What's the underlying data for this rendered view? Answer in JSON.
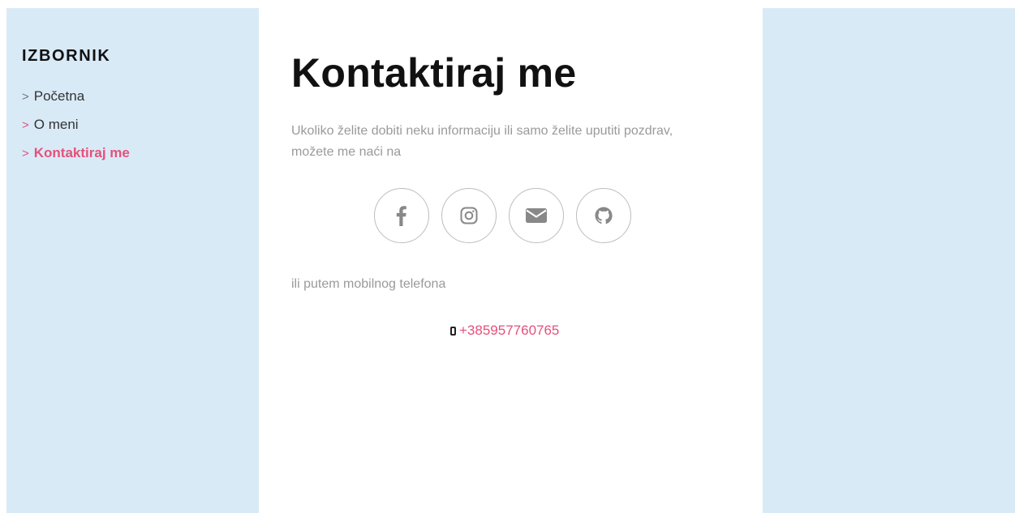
{
  "sidebar": {
    "title": "IZBORNIK",
    "items": [
      {
        "label": "Početna",
        "chevron": ">"
      },
      {
        "label": "O meni",
        "chevron": ">"
      },
      {
        "label": "Kontaktiraj me",
        "chevron": ">",
        "active": true
      }
    ]
  },
  "main": {
    "title": "Kontaktiraj me",
    "intro": "Ukoliko želite dobiti neku informaciju ili samo želite uputiti pozdrav, možete me naći na",
    "socials": [
      {
        "icon": "facebook-icon"
      },
      {
        "icon": "instagram-icon"
      },
      {
        "icon": "email-icon"
      },
      {
        "icon": "github-icon"
      }
    ],
    "phone_text": "ili putem mobilnog telefona",
    "phone_number": "+385957760765"
  },
  "colors": {
    "accent": "#e5517a",
    "panel_bg": "#d9eaf7",
    "muted_text": "#9a9a9a",
    "icon_gray": "#888888"
  }
}
